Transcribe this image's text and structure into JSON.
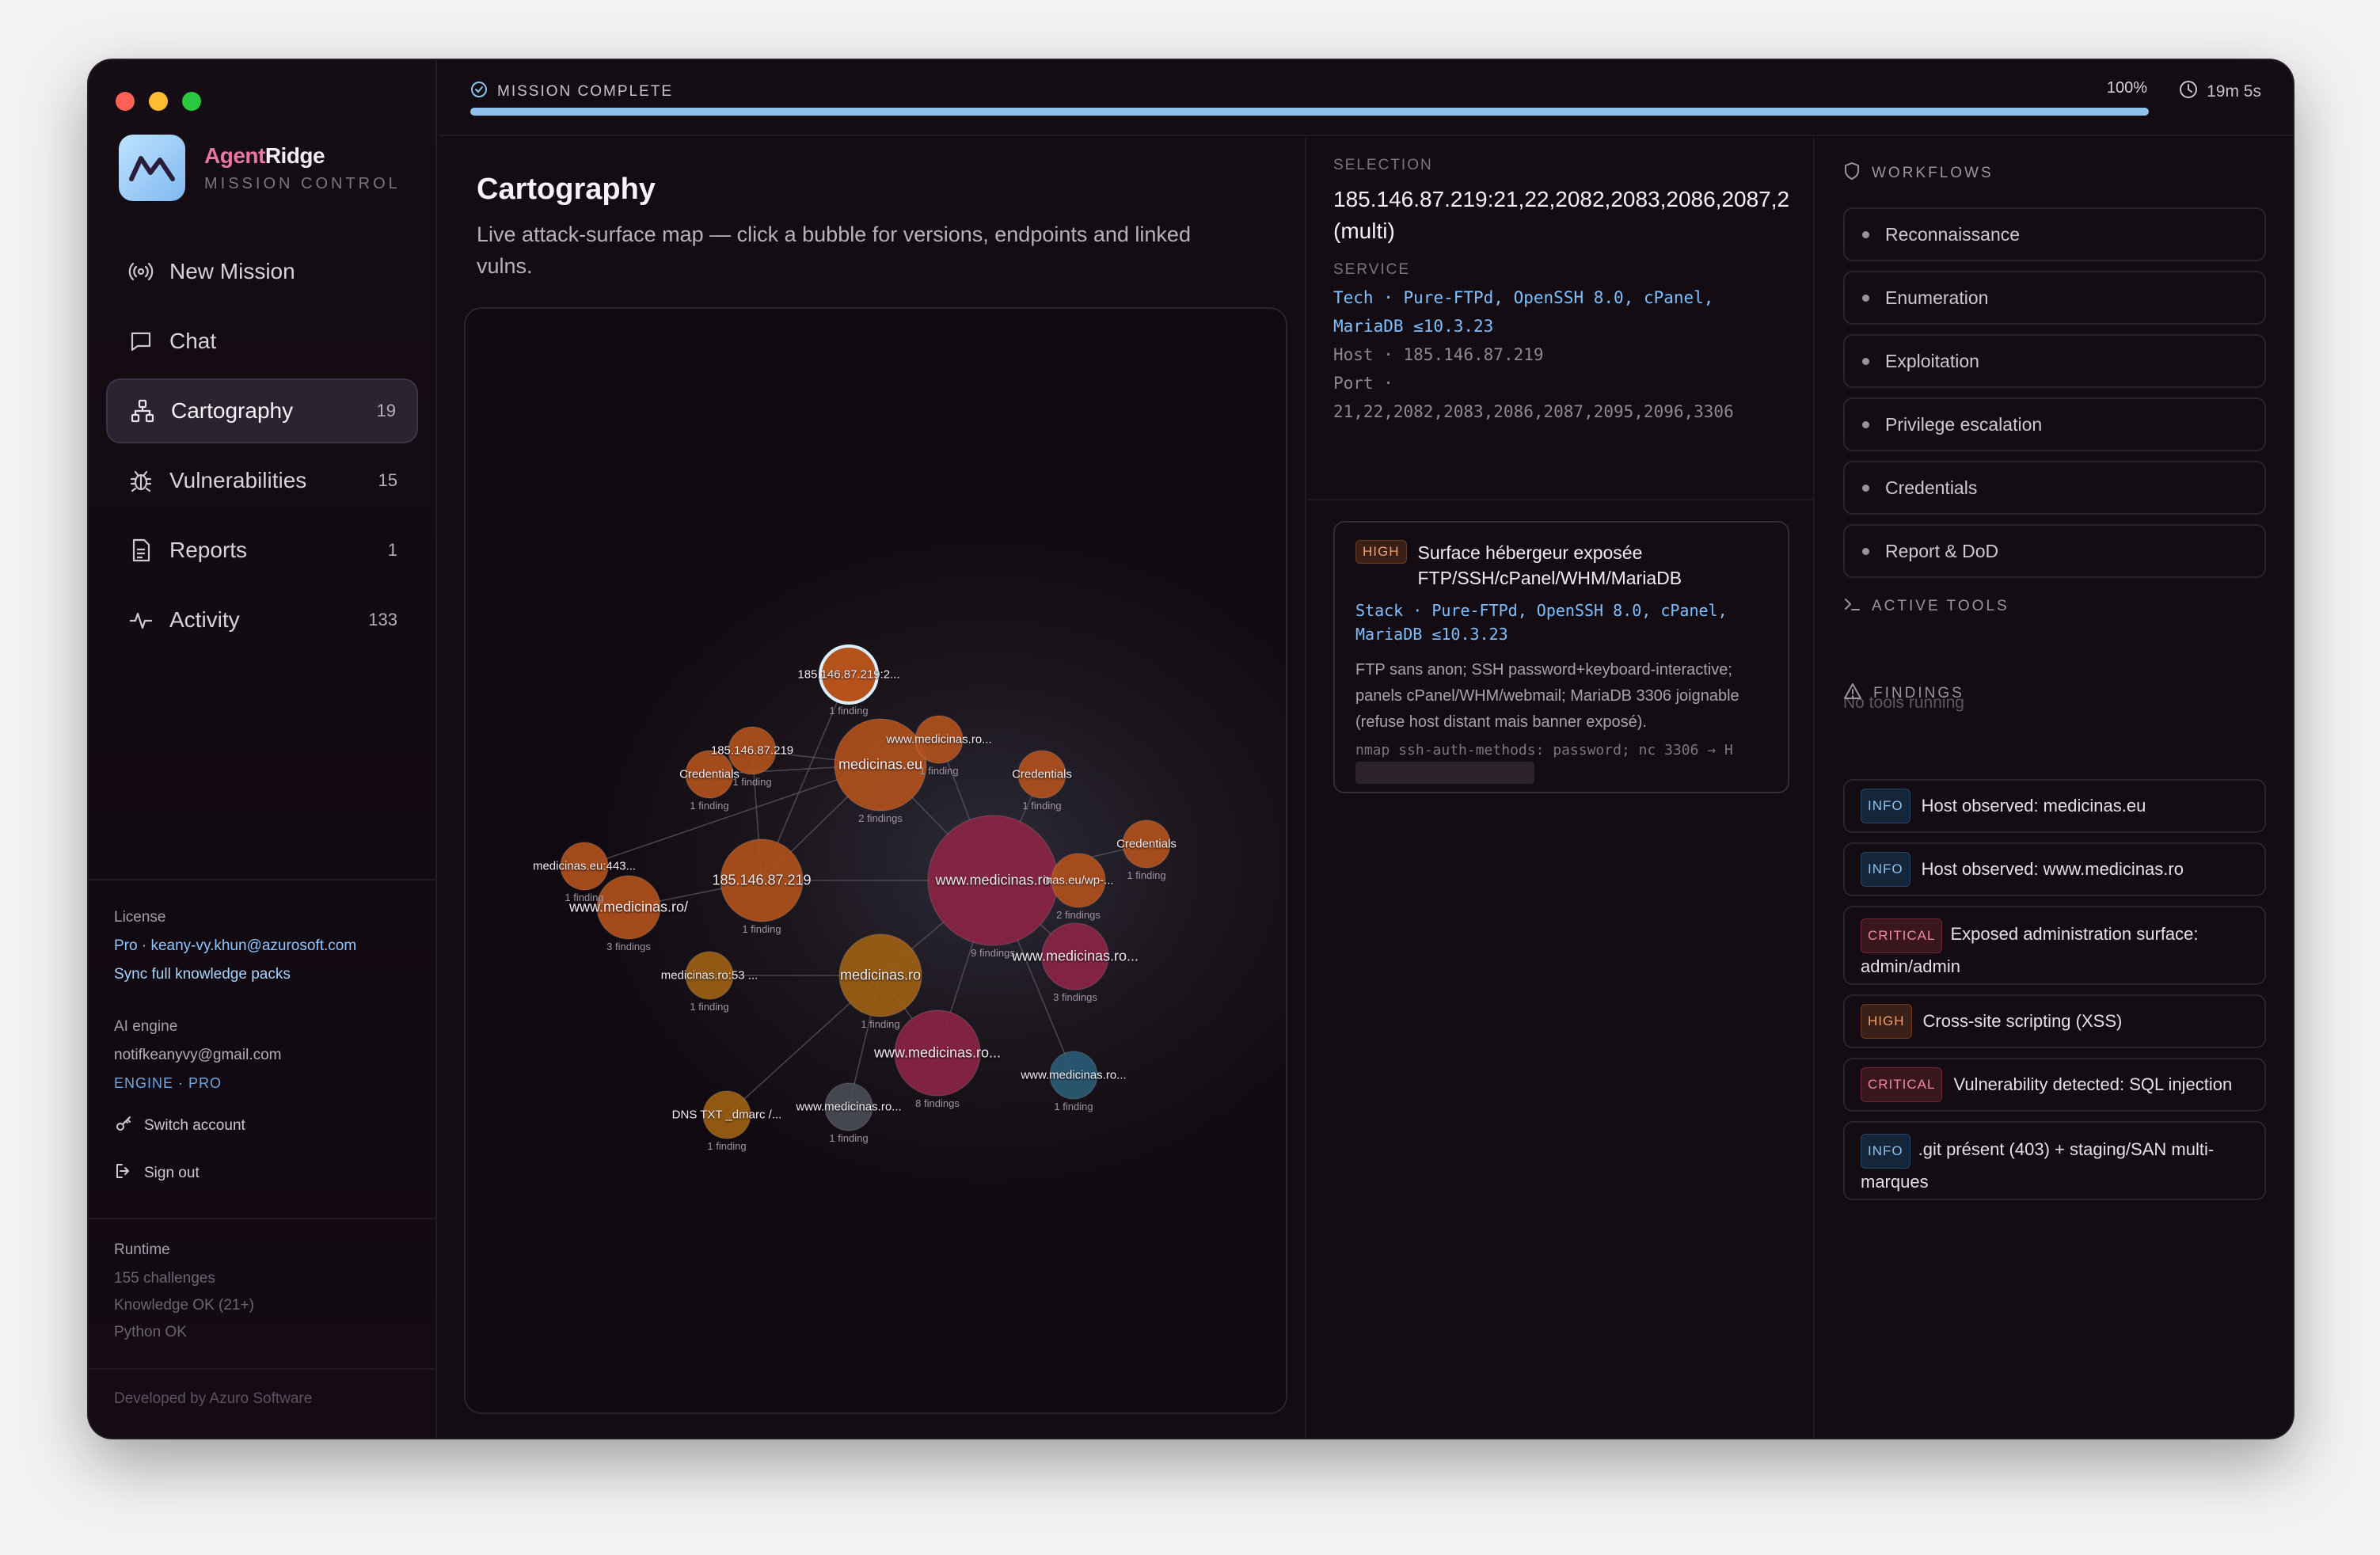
{
  "app": {
    "brand_a": "Agent",
    "brand_b": "Ridge",
    "brand_sub": "MISSION CONTROL"
  },
  "nav": [
    {
      "label": "New Mission",
      "count": "",
      "icon": "broadcast-icon"
    },
    {
      "label": "Chat",
      "count": "",
      "icon": "chat-icon"
    },
    {
      "label": "Cartography",
      "count": "19",
      "icon": "network-icon",
      "active": true
    },
    {
      "label": "Vulnerabilities",
      "count": "15",
      "icon": "bug-icon"
    },
    {
      "label": "Reports",
      "count": "1",
      "icon": "document-icon"
    },
    {
      "label": "Activity",
      "count": "133",
      "icon": "pulse-icon"
    }
  ],
  "license": {
    "heading": "License",
    "plan": "Pro · keany-vy.khun@azurosoft.com",
    "sync": "Sync full knowledge packs"
  },
  "ai_engine": {
    "heading": "AI engine",
    "email": "notifkeanyvy@gmail.com",
    "engine": "ENGINE · PRO",
    "switch": "Switch account",
    "signout": "Sign out"
  },
  "runtime": {
    "heading": "Runtime",
    "challenges": "155 challenges",
    "knowledge": "Knowledge OK (21+)",
    "python": "Python OK"
  },
  "footer": "Developed by Azuro Software",
  "topbar": {
    "status": "MISSION COMPLETE",
    "percent": "100%",
    "progress": 1.0,
    "timer": "19m 5s"
  },
  "main": {
    "title": "Cartography",
    "subtitle": "Live attack-surface map — click a bubble for versions, endpoints and linked vulns."
  },
  "graph": {
    "nodes": [
      {
        "id": "hub",
        "label": "www.medicinas.ro",
        "sub": "9 findings",
        "color": "#8a2444",
        "r": 82,
        "big": true
      },
      {
        "id": "eu",
        "label": "medicinas.eu",
        "sub": "2 findings",
        "color": "#b0501c",
        "r": 58,
        "big": true
      },
      {
        "id": "ip1",
        "label": "185.146.87.219",
        "sub": "1 finding",
        "color": "#b0501c",
        "r": 52,
        "big": true
      },
      {
        "id": "ro",
        "label": "medicinas.ro",
        "sub": "1 finding",
        "color": "#9c6014",
        "r": 52,
        "big": true
      },
      {
        "id": "rossl",
        "label": "www.medicinas.ro...",
        "sub": "8 findings",
        "color": "#8a2444",
        "r": 54,
        "big": true
      },
      {
        "id": "ro2",
        "label": "www.medicinas.ro...",
        "sub": "3 findings",
        "color": "#8a2444",
        "r": 42,
        "big": true
      },
      {
        "id": "roslash",
        "label": "www.medicinas.ro/",
        "sub": "3 findings",
        "color": "#b0501c",
        "r": 40,
        "big": true
      },
      {
        "id": "euwp",
        "label": "inas.eu/wp-...",
        "sub": "2 findings",
        "color": "#b0501c",
        "r": 34
      },
      {
        "id": "sel",
        "label": "185.146.87.219:2...",
        "sub": "1 finding",
        "color": "#c2581c",
        "r": 36,
        "selected": true
      },
      {
        "id": "ip2",
        "label": "185.146.87.219",
        "sub": "1 finding",
        "color": "#b0501c",
        "r": 30
      },
      {
        "id": "wro",
        "label": "www.medicinas.ro...",
        "sub": "1 finding",
        "color": "#b0501c",
        "r": 30
      },
      {
        "id": "cred1",
        "label": "Credentials",
        "sub": "1 finding",
        "color": "#b0501c",
        "r": 30
      },
      {
        "id": "cred2",
        "label": "Credentials",
        "sub": "1 finding",
        "color": "#b0501c",
        "r": 30
      },
      {
        "id": "cred3",
        "label": "Credentials",
        "sub": "1 finding",
        "color": "#b0501c",
        "r": 30
      },
      {
        "id": "eu443",
        "label": "medicinas.eu:443...",
        "sub": "1 finding",
        "color": "#b0501c",
        "r": 30
      },
      {
        "id": "ro53",
        "label": "medicinas.ro:53 ...",
        "sub": "1 finding",
        "color": "#9c6014",
        "r": 30
      },
      {
        "id": "dns",
        "label": "DNS TXT _dmarc /...",
        "sub": "1 finding",
        "color": "#9c6014",
        "r": 30
      },
      {
        "id": "grey",
        "label": "www.medicinas.ro...",
        "sub": "1 finding",
        "color": "#4a4c56",
        "r": 30
      },
      {
        "id": "teal",
        "label": "www.medicinas.ro...",
        "sub": "1 finding",
        "color": "#2a5a74",
        "r": 30
      }
    ]
  },
  "selection": {
    "label": "SELECTION",
    "title": "185.146.87.219:21,22,2082,2083,2086,2087,2",
    "title2": "(multi)",
    "service_label": "SERVICE",
    "tech_key": "Tech ·",
    "tech": "Pure-FTPd, OpenSSH 8.0, cPanel,",
    "tech2": "MariaDB ≤10.3.23",
    "host_key": "Host ·",
    "host": "185.146.87.219",
    "port_key": "Port ·",
    "port": "21,22,2082,2083,2086,2087,2095,2096,3306"
  },
  "finding_card": {
    "severity": "HIGH",
    "title": "Surface hébergeur exposée FTP/SSH/cPanel/WHM/MariaDB",
    "stack_key": "Stack ·",
    "stack": "Pure-FTPd, OpenSSH 8.0, cPanel,",
    "stack2": "MariaDB ≤10.3.23",
    "desc": "FTP sans anon; SSH password+keyboard-interactive; panels cPanel/WHM/webmail; MariaDB 3306 joignable (refuse host distant mais banner exposé).",
    "cmd": "nmap ssh-auth-methods: password; nc 3306 → H"
  },
  "workflows": {
    "heading": "WORKFLOWS",
    "items": [
      "Reconnaissance",
      "Enumeration",
      "Exploitation",
      "Privilege escalation",
      "Credentials",
      "Report & DoD"
    ]
  },
  "active_tools": {
    "heading": "ACTIVE TOOLS",
    "empty": "No tools running"
  },
  "findings": {
    "heading": "FINDINGS",
    "items": [
      {
        "severity": "INFO",
        "text": "Host observed: medicinas.eu"
      },
      {
        "severity": "INFO",
        "text": "Host observed: www.medicinas.ro"
      },
      {
        "severity": "CRITICAL",
        "text": "Exposed administration surface: admin/admin"
      },
      {
        "severity": "HIGH",
        "text": "Cross-site scripting (XSS)"
      },
      {
        "severity": "CRITICAL",
        "text": "Vulnerability detected: SQL injection"
      },
      {
        "severity": "INFO",
        "text": ".git présent (403) + staging/SAN multi-marques"
      }
    ]
  },
  "colors": {
    "accent": "#8fc3ee",
    "critical": "#8a2444",
    "high": "#b0501c",
    "medium": "#9c6014"
  }
}
